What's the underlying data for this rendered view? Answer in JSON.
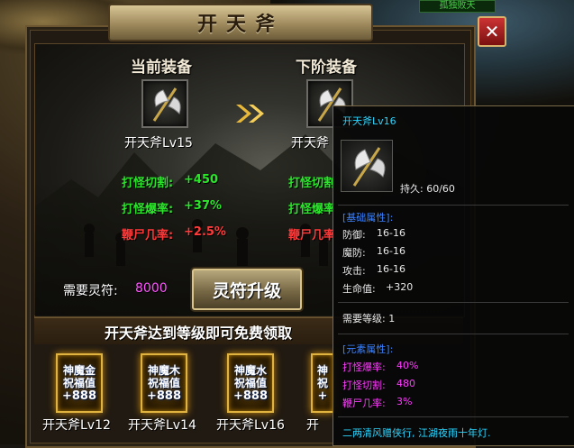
{
  "window": {
    "title": "开天斧",
    "close_label": "✕",
    "player_tag": "孤独败天"
  },
  "current": {
    "heading": "当前装备",
    "item_name": "开天斧Lv15",
    "icon": "axe-icon",
    "stats": [
      {
        "label": "打怪切割:",
        "value": "+450",
        "color": "#2ce62c"
      },
      {
        "label": "打怪爆率:",
        "value": "+37%",
        "color": "#2ce62c"
      },
      {
        "label": "鞭尸几率:",
        "value": "+2.5%",
        "color": "#ff3a3a"
      }
    ]
  },
  "next": {
    "heading": "下阶装备",
    "item_name": "开天斧",
    "icon": "axe-icon",
    "stats": [
      {
        "label": "打怪切割"
      },
      {
        "label": "打怪爆率"
      },
      {
        "label": "鞭尸几率"
      }
    ]
  },
  "requirement": {
    "label": "需要灵符:",
    "value": "8000"
  },
  "upgrade_button": "灵符升级",
  "banner": "开天斧达到等级即可免费领取",
  "rewards": [
    {
      "line1": "神魔金",
      "line2": "祝福值",
      "amount": "+888",
      "caption": "开天斧Lv12"
    },
    {
      "line1": "神魔木",
      "line2": "祝福值",
      "amount": "+888",
      "caption": "开天斧Lv14"
    },
    {
      "line1": "神魔水",
      "line2": "祝福值",
      "amount": "+888",
      "caption": "开天斧Lv16"
    },
    {
      "line1": "神",
      "line2": "祝",
      "amount": "+",
      "caption": "开"
    }
  ],
  "tooltip": {
    "title": "开天斧Lv16",
    "durability": "持久: 60/60",
    "base_header": "[基础属性]:",
    "base_stats": [
      {
        "label": "防御:",
        "value": "16-16"
      },
      {
        "label": "魔防:",
        "value": "16-16"
      },
      {
        "label": "攻击:",
        "value": "16-16"
      },
      {
        "label": "生命值:",
        "value": "+320"
      }
    ],
    "level_req": "需要等级: 1",
    "element_header": "[元素属性]:",
    "element_stats": [
      {
        "label": "打怪爆率:",
        "value": "40%"
      },
      {
        "label": "打怪切割:",
        "value": "480"
      },
      {
        "label": "鞭尸几率:",
        "value": "3%"
      }
    ],
    "flavor": "二两清风赠侠行, 江湖夜雨十年灯."
  }
}
